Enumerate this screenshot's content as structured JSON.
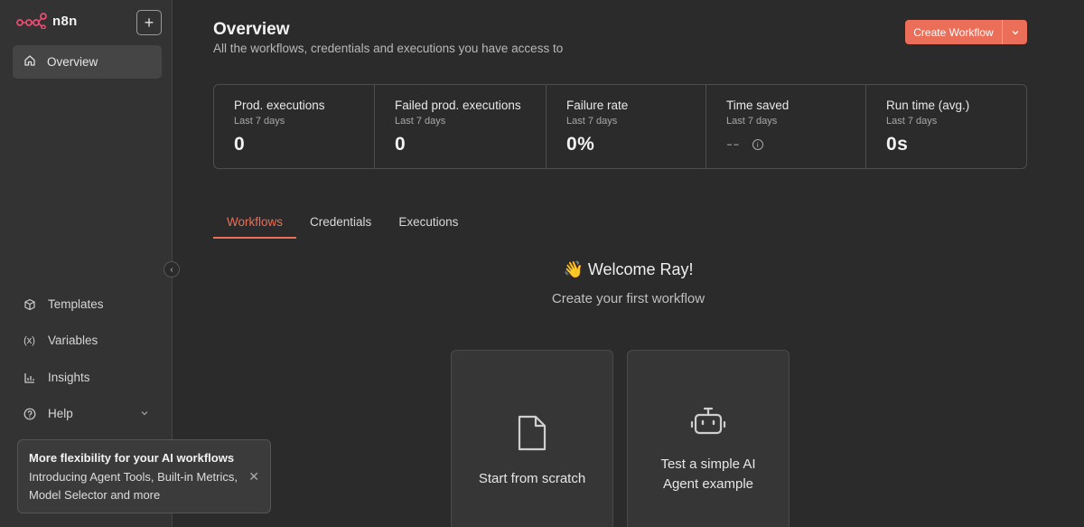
{
  "app": {
    "name": "n8n"
  },
  "sidebar": {
    "new_button": "+",
    "overview_label": "Overview",
    "items": [
      {
        "label": "Templates",
        "icon": "box-icon"
      },
      {
        "label": "Variables",
        "icon": "variables-icon"
      },
      {
        "label": "Insights",
        "icon": "chart-icon"
      },
      {
        "label": "Help",
        "icon": "help-icon"
      }
    ],
    "collapse_icon": "chevron-left-icon"
  },
  "toast": {
    "title": "More flexibility for your AI workflows",
    "body": "Introducing Agent Tools, Built-in Metrics, Model Selector and more"
  },
  "header": {
    "title": "Overview",
    "subtitle": "All the workflows, credentials and executions you have access to",
    "create_label": "Create Workflow"
  },
  "stats": [
    {
      "name": "Prod. executions",
      "period": "Last 7 days",
      "value": "0"
    },
    {
      "name": "Failed prod. executions",
      "period": "Last 7 days",
      "value": "0"
    },
    {
      "name": "Failure rate",
      "period": "Last 7 days",
      "value": "0%"
    },
    {
      "name": "Time saved",
      "period": "Last 7 days",
      "value": "--"
    },
    {
      "name": "Run time (avg.)",
      "period": "Last 7 days",
      "value": "0s"
    }
  ],
  "tabs": [
    {
      "label": "Workflows",
      "active": true
    },
    {
      "label": "Credentials",
      "active": false
    },
    {
      "label": "Executions",
      "active": false
    }
  ],
  "welcome": {
    "title": "👋 Welcome Ray!",
    "subtitle": "Create your first workflow"
  },
  "cards": [
    {
      "label": "Start from scratch",
      "icon": "file-icon"
    },
    {
      "label": "Test a simple AI Agent example",
      "icon": "robot-icon"
    }
  ],
  "colors": {
    "accent": "#ea6e58",
    "background": "#2b2b2b",
    "sidebar": "#333333"
  }
}
